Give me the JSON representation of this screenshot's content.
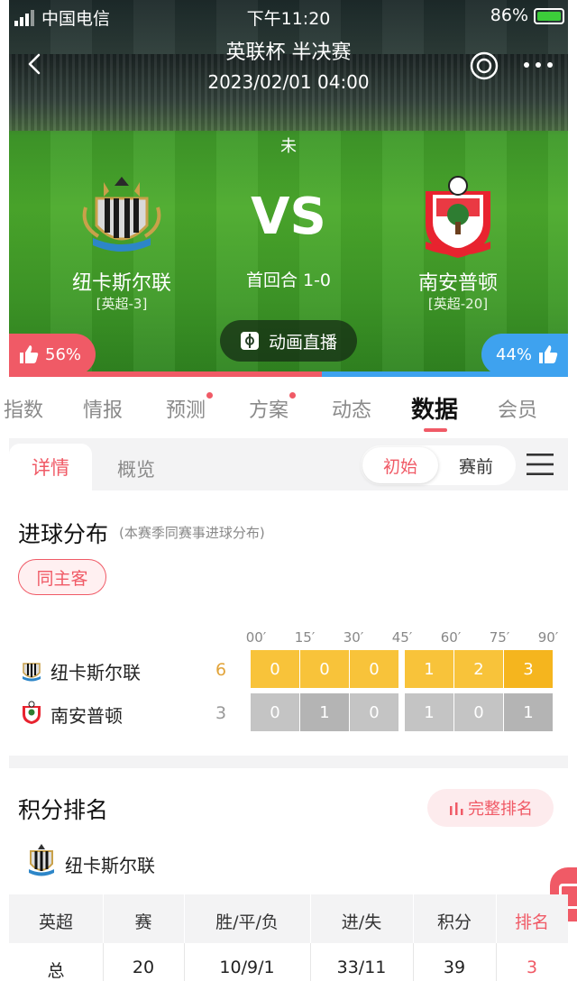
{
  "status_bar": {
    "carrier": "中国电信",
    "time": "下午11:20",
    "battery": "86%"
  },
  "match": {
    "title": "英联杯 半决赛",
    "datetime": "2023/02/01 04:00",
    "state": "未",
    "vs": "VS",
    "first_leg": "首回合 1-0",
    "home": {
      "name": "纽卡斯尔联",
      "league": "[英超-3]"
    },
    "away": {
      "name": "南安普顿",
      "league": "[英超-20]"
    },
    "live_label": "动画直播",
    "vote_home": "56%",
    "vote_away": "44%",
    "vote_home_share": 0.56
  },
  "tabs": [
    {
      "label": "指数"
    },
    {
      "label": "情报"
    },
    {
      "label": "预测"
    },
    {
      "label": "方案"
    },
    {
      "label": "动态"
    },
    {
      "label": "数据"
    },
    {
      "label": "会员"
    }
  ],
  "subtabs": {
    "detail": "详情",
    "overview": "概览",
    "initial": "初始",
    "prematch": "赛前"
  },
  "goal_distribution": {
    "title": "进球分布",
    "subtitle": "(本赛季同赛事进球分布)",
    "filter": "同主客",
    "ticks": [
      "00′",
      "15′",
      "30′",
      "45′",
      "60′",
      "75′",
      "90′"
    ],
    "rows": [
      {
        "team": "纽卡斯尔联",
        "total": "6",
        "values": [
          "0",
          "0",
          "0",
          "1",
          "2",
          "3"
        ]
      },
      {
        "team": "南安普顿",
        "total": "3",
        "values": [
          "0",
          "1",
          "0",
          "1",
          "0",
          "1"
        ]
      }
    ],
    "colors": {
      "home": "#f8c33a",
      "home_alt": "#f5b51e",
      "away": "#c4c4c4",
      "away_alt": "#b4b4b4",
      "home_total": "#e2a43a",
      "away_total": "#999999"
    }
  },
  "standings": {
    "title": "积分排名",
    "full_button": "完整排名",
    "team": "纽卡斯尔联",
    "headers": [
      "英超",
      "赛",
      "胜/平/负",
      "进/失",
      "积分",
      "排名"
    ],
    "row": [
      "总",
      "20",
      "10/9/1",
      "33/11",
      "39",
      "3"
    ]
  },
  "colors": {
    "accent": "#f05a66",
    "away_blue": "#3ea2ef"
  }
}
